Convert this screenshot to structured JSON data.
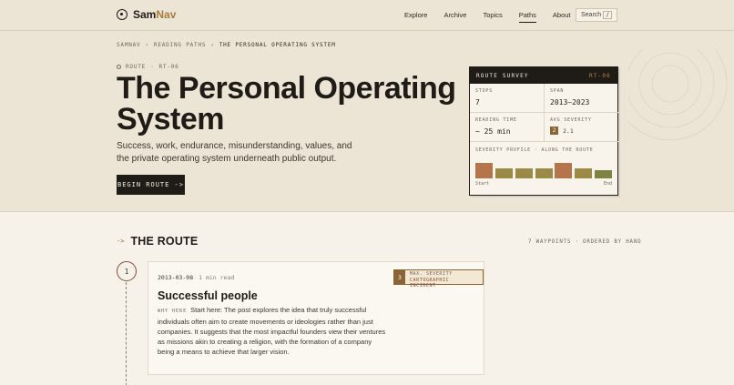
{
  "brand": {
    "name_a": "Sam",
    "name_b": "Nav"
  },
  "nav": {
    "items": [
      {
        "label": "Explore"
      },
      {
        "label": "Archive"
      },
      {
        "label": "Topics"
      },
      {
        "label": "Paths",
        "active": true
      },
      {
        "label": "About"
      }
    ],
    "search_label": "Search",
    "search_key": "/"
  },
  "breadcrumb": {
    "root": "SAMNAV",
    "section": "READING PATHS",
    "current": "THE PERSONAL OPERATING SYSTEM",
    "sep": "›"
  },
  "hero": {
    "route_label": "ROUTE",
    "route_code": "RT-06",
    "title": "The Personal Operating System",
    "subtitle": "Success, work, endurance, misunderstanding, values, and the private operating system underneath public output.",
    "cta": "BEGIN ROUTE ->"
  },
  "survey": {
    "title": "ROUTE SURVEY",
    "code": "RT-06",
    "stops_label": "STOPS",
    "stops_value": "7",
    "span_label": "SPAN",
    "span_value": "2013–2023",
    "reading_label": "READING TIME",
    "reading_value": "~ 25 min",
    "severity_label": "AVG SEVERITY",
    "severity_badge": "2",
    "severity_value": "2.1",
    "profile_label": "SEVERITY PROFILE · ALONG THE ROUTE",
    "start_label": "Start",
    "end_label": "End"
  },
  "chart_data": {
    "type": "bar",
    "categories": [
      "1",
      "2",
      "3",
      "4",
      "5",
      "6",
      "7"
    ],
    "values": [
      3,
      2,
      2,
      2,
      3,
      2,
      1.5
    ],
    "colors": [
      "#b5754a",
      "#9b8a45",
      "#9b8a45",
      "#9b8a45",
      "#b5754a",
      "#9b8a45",
      "#7d8442"
    ],
    "ylim": [
      0,
      3.5
    ],
    "title": "",
    "xlabel": "",
    "ylabel": ""
  },
  "route": {
    "arrow": "->",
    "title": "THE ROUTE",
    "meta": "7 WAYPOINTS · ORDERED BY HAND"
  },
  "stop": {
    "number": "1",
    "date": "2013-03-08",
    "read_time": "1 min read",
    "severity_num": "3",
    "severity_label": "MAX. SEVERITY",
    "severity_text": "CARTOGRAPHIC INCIDENT",
    "title": "Successful people",
    "why_label": "WHY HERE",
    "body": "Start here: The post explores the idea that truly successful individuals often aim to create movements or ideologies rather than just companies. It suggests that the most impactful founders view their ventures as missions akin to creating a religion, with the formation of a company being a means to achieve that larger vision."
  },
  "colors": {
    "accent": "#a57d3a",
    "ink": "#1f1b16",
    "rust": "#8a4b34"
  }
}
